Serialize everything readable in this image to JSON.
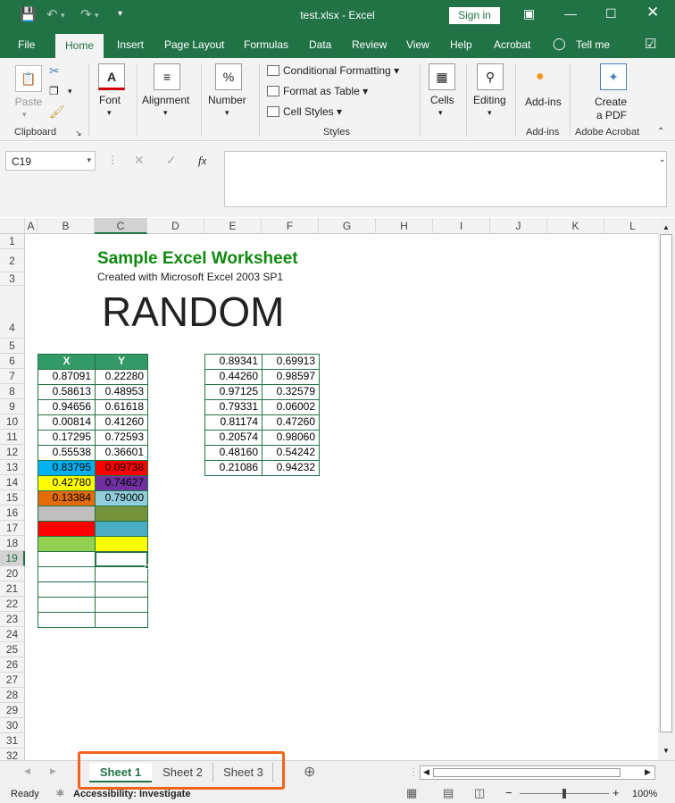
{
  "titlebar": {
    "filename": "test.xlsx",
    "app": "Excel",
    "title": "test.xlsx  -  Excel",
    "signin": "Sign in"
  },
  "tabs": [
    "File",
    "Home",
    "Insert",
    "Page Layout",
    "Formulas",
    "Data",
    "Review",
    "View",
    "Help",
    "Acrobat",
    "Tell me"
  ],
  "ribbon": {
    "paste": "Paste",
    "clipboard": "Clipboard",
    "font": "Font",
    "alignment": "Alignment",
    "number": "Number",
    "conditional": "Conditional Formatting",
    "format_table": "Format as Table",
    "cell_styles": "Cell Styles",
    "styles": "Styles",
    "cells": "Cells",
    "editing": "Editing",
    "addins_btn": "Add-ins",
    "addins_group": "Add-ins",
    "create_pdf_1": "Create",
    "create_pdf_2": "a PDF",
    "acrobat_group": "Adobe Acrobat"
  },
  "formula_bar": {
    "name_box": "C19",
    "fx": "fx",
    "value": ""
  },
  "columns": [
    "A",
    "B",
    "C",
    "D",
    "E",
    "F",
    "G",
    "H",
    "I",
    "J",
    "K",
    "L"
  ],
  "rows": [
    "1",
    "2",
    "3",
    "4",
    "5",
    "6",
    "7",
    "8",
    "9",
    "10",
    "11",
    "12",
    "13",
    "14",
    "15",
    "16",
    "17",
    "18",
    "19",
    "20",
    "21",
    "22",
    "23",
    "24",
    "25",
    "26",
    "27",
    "28",
    "29",
    "30",
    "31",
    "32"
  ],
  "sheet": {
    "title": "Sample Excel Worksheet",
    "subtitle": "Created with Microsoft Excel 2003 SP1",
    "random": "RANDOM",
    "x_header": "X",
    "y_header": "Y",
    "table1": [
      [
        "0.87091",
        "0.22280"
      ],
      [
        "0.58613",
        "0.48953"
      ],
      [
        "0.94656",
        "0.61618"
      ],
      [
        "0.00814",
        "0.41260"
      ],
      [
        "0.17295",
        "0.72593"
      ],
      [
        "0.55538",
        "0.36601"
      ],
      [
        "0.83795",
        "0.09738"
      ],
      [
        "0.42780",
        "0.74627"
      ],
      [
        "0.13384",
        "0.79000"
      ]
    ],
    "table2": [
      [
        "0.89341",
        "0.69913"
      ],
      [
        "0.44260",
        "0.98597"
      ],
      [
        "0.97125",
        "0.32579"
      ],
      [
        "0.79331",
        "0.06002"
      ],
      [
        "0.81174",
        "0.47260"
      ],
      [
        "0.20574",
        "0.98060"
      ],
      [
        "0.48160",
        "0.54242"
      ],
      [
        "0.21086",
        "0.94232"
      ]
    ]
  },
  "colors": {
    "excel_green": "#217346",
    "header_green": "#339966",
    "highlight": "#f0641e"
  },
  "sheets": [
    "Sheet 1",
    "Sheet 2",
    "Sheet 3"
  ],
  "status": {
    "ready": "Ready",
    "accessibility": "Accessibility: Investigate",
    "zoom": "100%"
  }
}
